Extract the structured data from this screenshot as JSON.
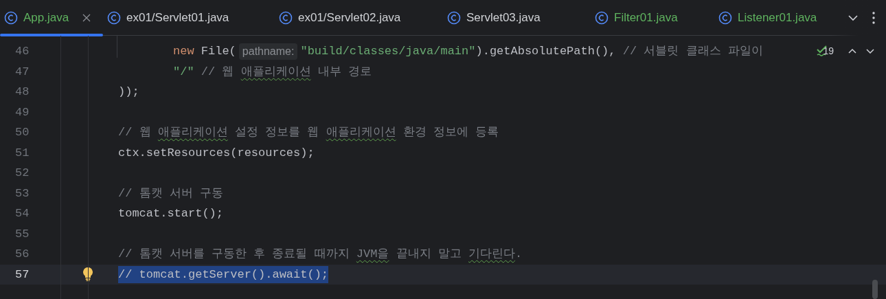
{
  "tabs": [
    {
      "label": "App.java",
      "selected": true,
      "color": "#5fb35f"
    },
    {
      "label": "ex01/Servlet01.java",
      "selected": false,
      "color": "#d0d2d6"
    },
    {
      "label": "ex01/Servlet02.java",
      "selected": false,
      "color": "#d0d2d6"
    },
    {
      "label": "Servlet03.java",
      "selected": false,
      "color": "#d0d2d6"
    },
    {
      "label": "Filter01.java",
      "selected": false,
      "color": "#5fb35f"
    },
    {
      "label": "Listener01.java",
      "selected": false,
      "color": "#5fb35f"
    }
  ],
  "editor": {
    "inspection_count": "19",
    "lines": [
      {
        "number": "46",
        "kind": "argument",
        "current": false,
        "bulb": false,
        "tokens": [
          {
            "kind": "keyword",
            "text": "new"
          },
          {
            "kind": "plain",
            "text": " File("
          },
          {
            "kind": "hint",
            "text": "pathname:"
          },
          {
            "kind": "string",
            "text": "\"build/classes/java/main\""
          },
          {
            "kind": "plain",
            "text": ").getAbsolutePath(), "
          },
          {
            "kind": "comment",
            "text": "// 서블릿 클래스 파일이"
          }
        ]
      },
      {
        "number": "47",
        "kind": "argument",
        "current": false,
        "bulb": false,
        "tokens": [
          {
            "kind": "string",
            "text": "\"/\""
          },
          {
            "kind": "comment",
            "text": " // 웹 "
          },
          {
            "kind": "typo",
            "text": "애플리케이션"
          },
          {
            "kind": "comment",
            "text": " 내부 경로"
          }
        ]
      },
      {
        "number": "48",
        "kind": "statement",
        "current": false,
        "bulb": false,
        "tokens": [
          {
            "kind": "plain",
            "text": "));"
          }
        ]
      },
      {
        "number": "49",
        "kind": "blank",
        "current": false,
        "bulb": false
      },
      {
        "number": "50",
        "kind": "statement",
        "current": false,
        "bulb": false,
        "tokens": [
          {
            "kind": "comment",
            "text": "// 웹 "
          },
          {
            "kind": "typo",
            "text": "애플리케이션"
          },
          {
            "kind": "comment",
            "text": " 설정 정보를 웹 "
          },
          {
            "kind": "typo",
            "text": "애플리케이션"
          },
          {
            "kind": "comment",
            "text": " 환경 정보에 등록"
          }
        ]
      },
      {
        "number": "51",
        "kind": "statement",
        "current": false,
        "bulb": false,
        "tokens": [
          {
            "kind": "plain",
            "text": "ctx.setResources(resources);"
          }
        ]
      },
      {
        "number": "52",
        "kind": "blank",
        "current": false,
        "bulb": false
      },
      {
        "number": "53",
        "kind": "statement",
        "current": false,
        "bulb": false,
        "tokens": [
          {
            "kind": "comment",
            "text": "// 톰캣 서버 구동"
          }
        ]
      },
      {
        "number": "54",
        "kind": "statement",
        "current": false,
        "bulb": false,
        "tokens": [
          {
            "kind": "plain",
            "text": "tomcat.start();"
          }
        ]
      },
      {
        "number": "55",
        "kind": "blank",
        "current": false,
        "bulb": false
      },
      {
        "number": "56",
        "kind": "statement",
        "current": false,
        "bulb": false,
        "tokens": [
          {
            "kind": "comment",
            "text": "// 톰캣 서버를 구동한 후 종료될 때까지 "
          },
          {
            "kind": "typo",
            "text": "JVM을"
          },
          {
            "kind": "comment",
            "text": " 끝내지 말고 "
          },
          {
            "kind": "typo",
            "text": "기다린다"
          },
          {
            "kind": "comment",
            "text": "."
          }
        ]
      },
      {
        "number": "57",
        "kind": "statement",
        "current": true,
        "bulb": true,
        "tokens": [
          {
            "kind": "selected",
            "text": "// tomcat.getServer().await();"
          }
        ]
      }
    ]
  }
}
